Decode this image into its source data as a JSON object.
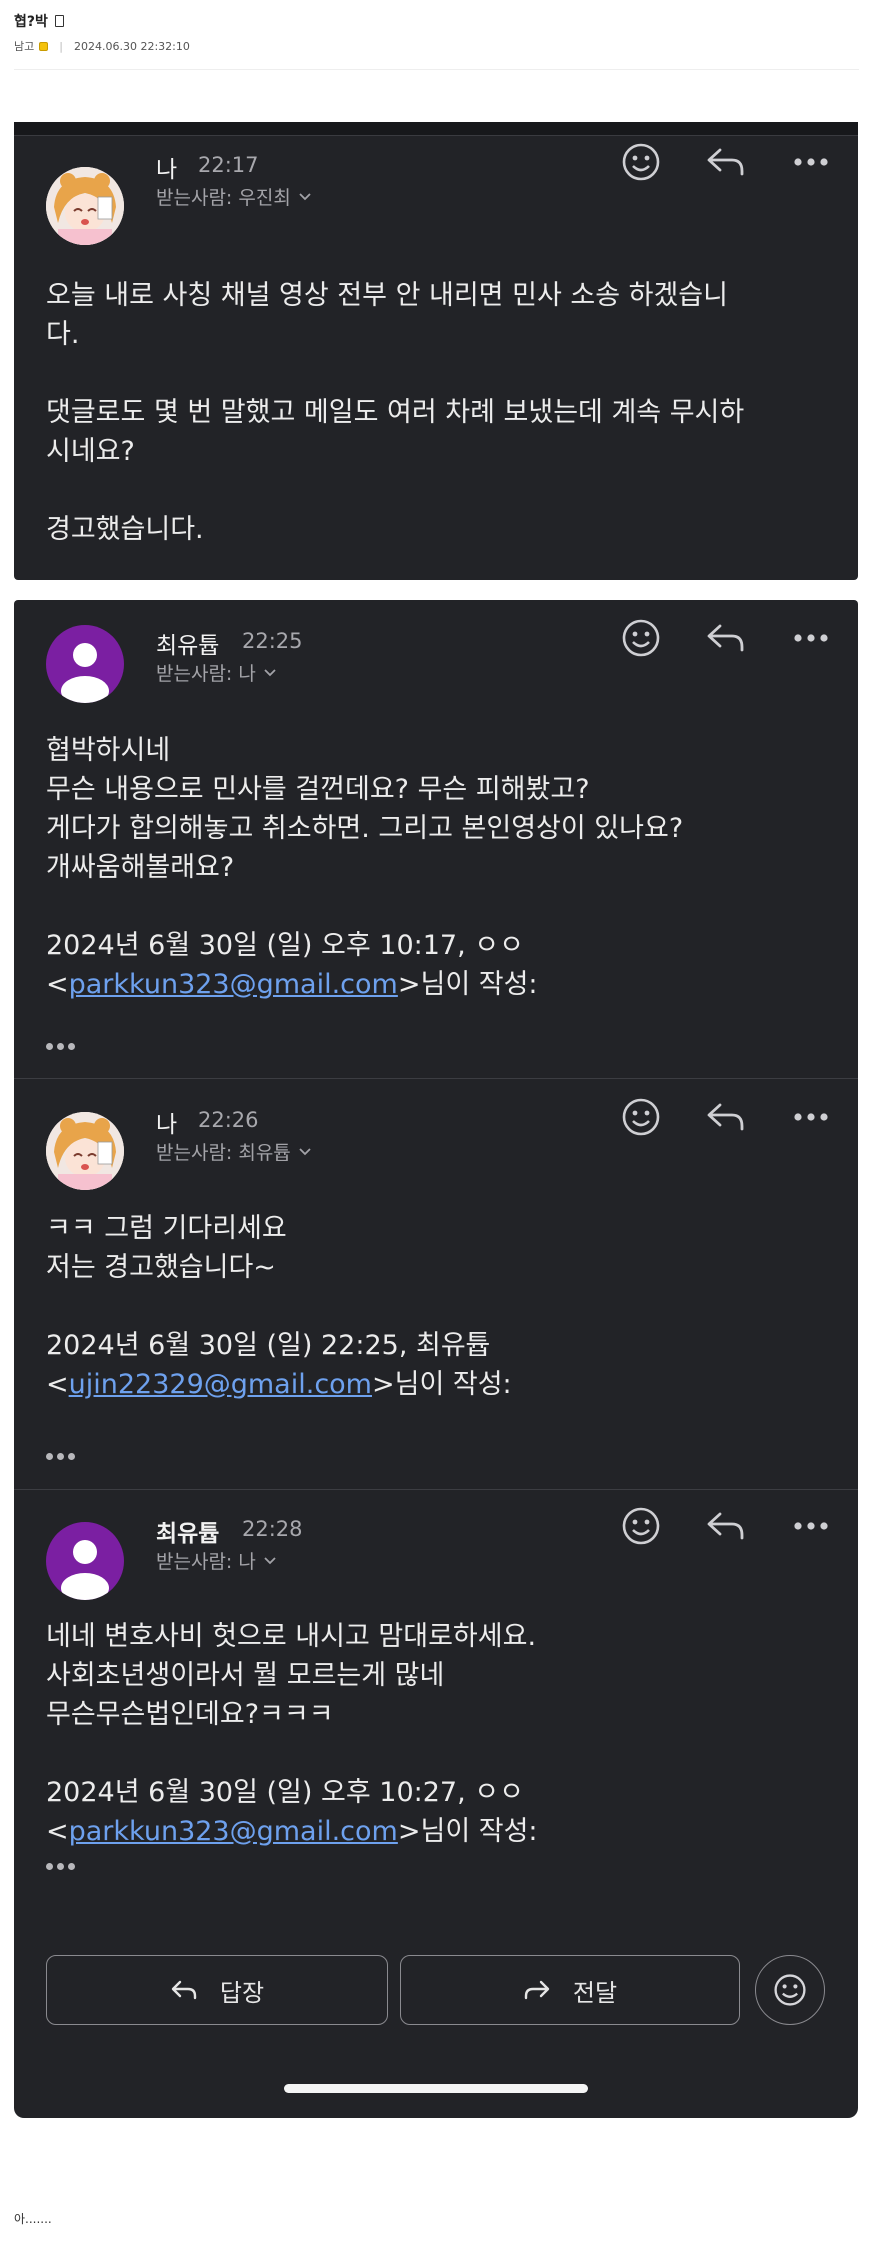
{
  "post": {
    "title": "협?박",
    "author": "남고",
    "datetime": "2024.06.30 22:32:10",
    "footer_text": "아......."
  },
  "messages": [
    {
      "sender": "나",
      "time": "22:17",
      "recipient": "받는사람: 우진최",
      "body": [
        "오늘 내로 사칭 채널 영상 전부 안 내리면 민사 소송 하겠습니",
        "다.",
        "",
        "댓글로도 몇 번 말했고 메일도 여러 차례 보냈는데 계속 무시하",
        "시네요?",
        "",
        "경고했습니다."
      ]
    },
    {
      "sender": "최유튭",
      "time": "22:25",
      "recipient": "받는사람: 나",
      "body": [
        "협박하시네",
        "무슨 내용으로 민사를 걸껀데요? 무슨 피해봤고?",
        "게다가 합의해놓고 취소하면. 그리고 본인영상이 있나요?",
        "개싸움해볼래요?",
        "",
        "2024년 6월 30일 (일) 오후 10:17, ㅇㅇ"
      ],
      "quote_prefix": "<",
      "quote_email": "parkkun323@gmail.com",
      "quote_suffix": ">님이 작성:"
    },
    {
      "sender": "나",
      "time": "22:26",
      "recipient": "받는사람: 최유튭",
      "body": [
        "ㅋㅋ 그럼 기다리세요",
        "저는 경고했습니다~",
        "",
        "2024년 6월 30일 (일) 22:25, 최유튭"
      ],
      "quote_prefix": "<",
      "quote_email": "ujin22329@gmail.com",
      "quote_suffix": ">님이 작성:"
    },
    {
      "sender": "최유튭",
      "time": "22:28",
      "recipient": "받는사람: 나",
      "body": [
        "네네 변호사비 헛으로 내시고 맘대로하세요.",
        "사회초년생이라서 뭘 모르는게 많네",
        "무슨무슨법인데요?ㅋㅋㅋ",
        "",
        "2024년 6월 30일 (일) 오후 10:27, ㅇㅇ"
      ],
      "quote_prefix": "<",
      "quote_email": "parkkun323@gmail.com",
      "quote_suffix": ">님이 작성:"
    }
  ],
  "footer_actions": {
    "reply_label": "답장",
    "forward_label": "전달"
  },
  "icons": {
    "emoji_reaction": "smile-icon",
    "reply": "reply-arrow-icon",
    "more": "more-horizontal-icon",
    "forward": "forward-arrow-icon",
    "dropdown": "chevron-down-icon"
  },
  "colors": {
    "mail_background": "#222327",
    "link": "#6ea1ee",
    "avatar_purple": "#7b1fa2"
  }
}
